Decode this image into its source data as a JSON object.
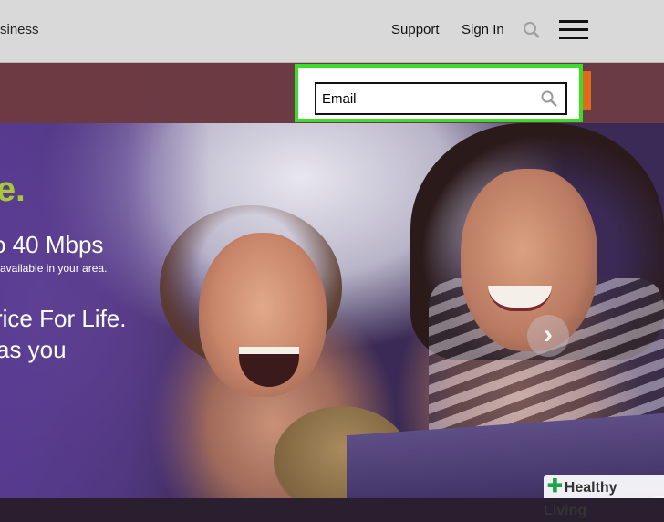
{
  "nav": {
    "left_text": "siness",
    "support": "Support",
    "signin": "Sign In",
    "search_icon": "search-icon",
    "menu_icon": "hamburger-menu-icon"
  },
  "email": {
    "value": "Email",
    "icon": "search-icon",
    "highlight_color": "#3cdc2a"
  },
  "hero": {
    "accent_text": "e.",
    "speed_text": "o 40 Mbps",
    "availability_text": "available in your area.",
    "price_line1": "rice For Life.",
    "price_line2": "as you",
    "next_icon": "chevron-right-icon"
  },
  "watermark": {
    "text": "Healthy Living"
  },
  "colors": {
    "accent_green": "#a8c83a",
    "strip_red": "#6e3a42",
    "strip_orange": "#e06a1e"
  }
}
